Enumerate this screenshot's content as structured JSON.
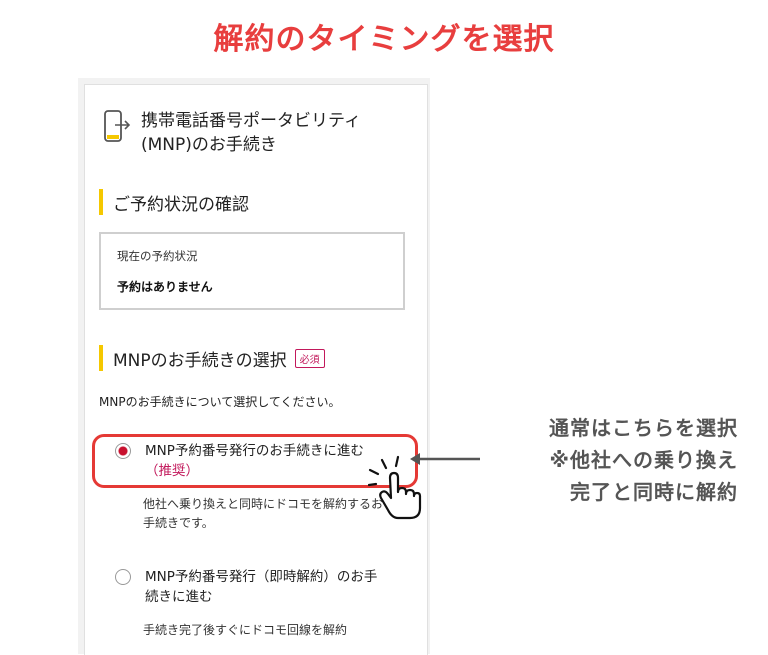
{
  "headline": "解約のタイミングを選択",
  "colors": {
    "headline": "#e83e3e",
    "accent_bar": "#f5c800",
    "highlight": "#e53935",
    "required": "#c2185b",
    "radio_selected": "#c8102e",
    "note": "#555555"
  },
  "mnp": {
    "title": "携帯電話番号ポータビリティ\n(MNP)のお手続き",
    "reservation_section": {
      "heading": "ご予約状況の確認",
      "status_label": "現在の予約状況",
      "status_value": "予約はありません"
    },
    "procedure_section": {
      "heading": "MNPのお手続きの選択",
      "required_badge": "必須",
      "description": "MNPのお手続きについて選択してください。",
      "options": [
        {
          "label": "MNP予約番号発行のお手続きに進む",
          "recommended": "（推奨）",
          "sub": "他社へ乗り換えと同時にドコモを解約するお手続きです。",
          "selected": true
        },
        {
          "label": "MNP予約番号発行（即時解約）のお手続きに進む",
          "sub": "手続き完了後すぐにドコモ回線を解約",
          "selected": false
        }
      ]
    }
  },
  "annotation": {
    "line1": "通常はこちらを選択",
    "line2": "※他社への乗り換え",
    "line3": "完了と同時に解約"
  }
}
